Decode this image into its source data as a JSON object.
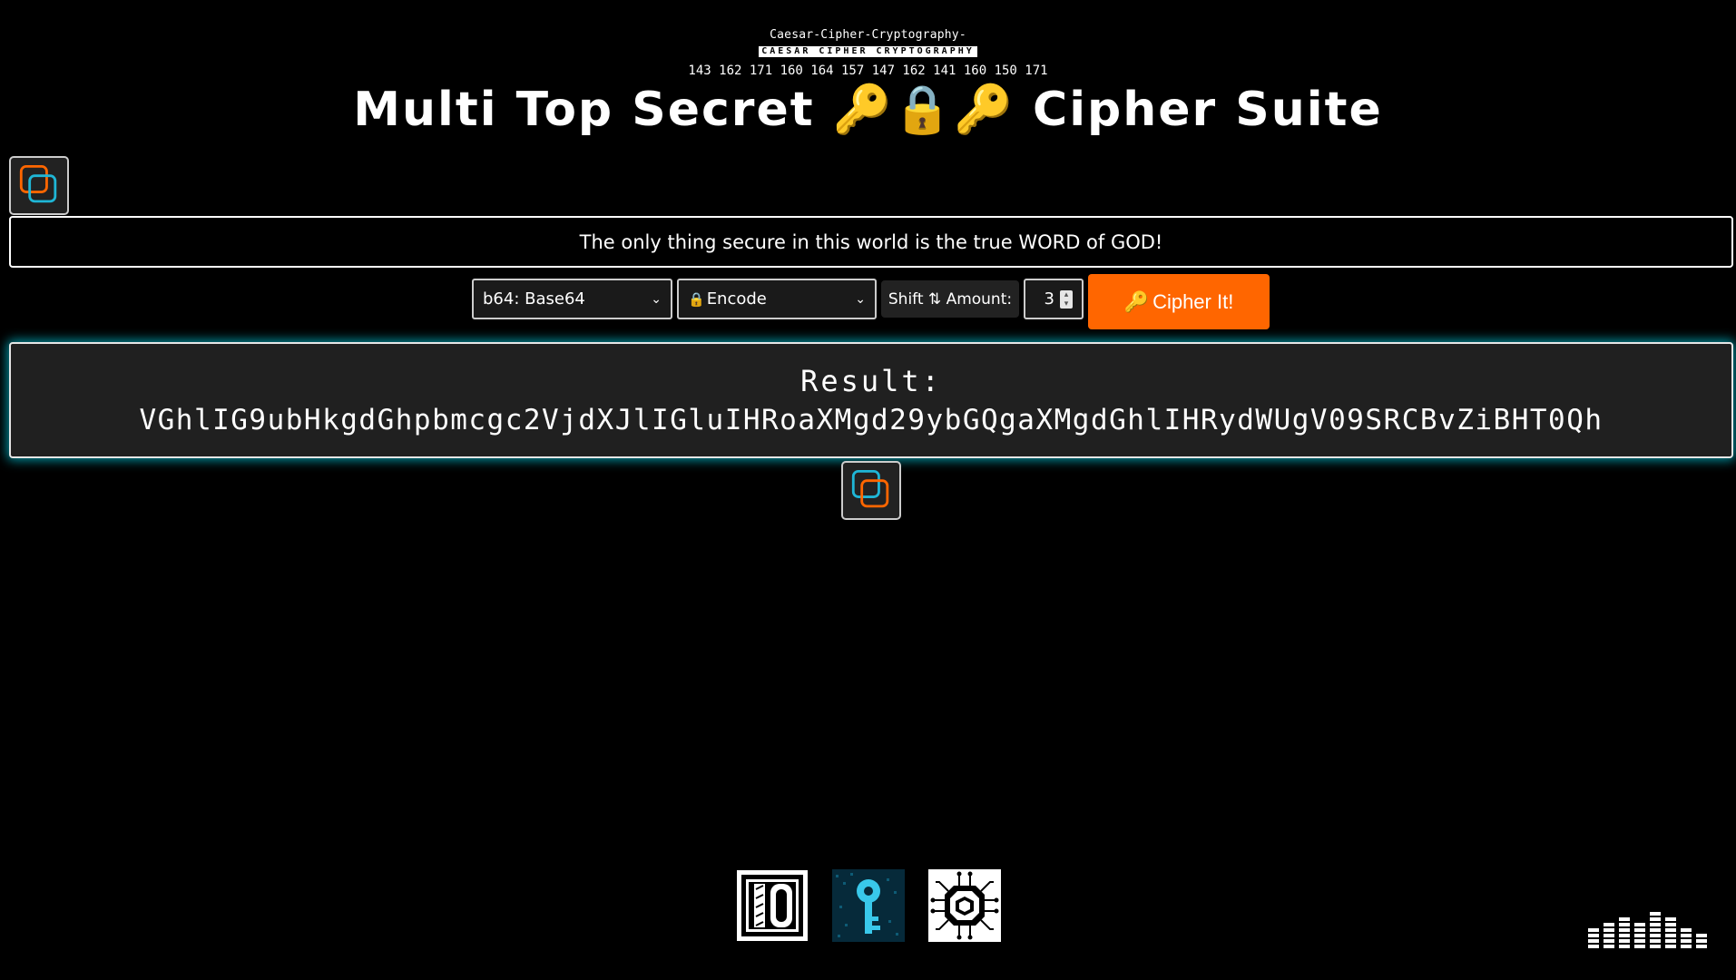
{
  "header": {
    "subtitle_mono": "Caesar-Cipher-Cryptography-",
    "subtitle_boxed": "CAESAR CIPHER CRYPTOGRAPHY",
    "subtitle_octal": "143 162 171 160 164 157 147 162 141 160 150 171",
    "title_left": "Multi Top Secret",
    "title_emoji": "🔑🔒🔑",
    "title_right": "Cipher Suite"
  },
  "message": {
    "text": "The only thing secure in this world is the true WORD of GOD!"
  },
  "controls": {
    "cipher_select": "b64: Base64",
    "mode_lock": "🔒",
    "mode_select": "Encode",
    "shift_label": "Shift ⇅ Amount:",
    "shift_value": "3",
    "cipher_button_emoji": "🔑",
    "cipher_button_label": "Cipher It!"
  },
  "result": {
    "label": "Result:",
    "value": "VGhlIG9ubHkgdGhpbmcgc2VjdXJlIGluIHRoaXMgd29ybGQgaXMgdGhlIHRydWUgV09SRCBvZiBHT0Qh"
  },
  "icons": {
    "copy_top": "copy-icon",
    "copy_bottom": "copy-icon",
    "footer": [
      "io-logo",
      "digital-key-logo",
      "network-chip-logo"
    ],
    "equalizer": "equalizer-icon"
  },
  "colors": {
    "background": "#000000",
    "accent_orange": "#ff6600",
    "accent_cyan": "#1fb6d6",
    "emoji_gold": "#f5a623",
    "result_glow": "#00c8dc"
  }
}
